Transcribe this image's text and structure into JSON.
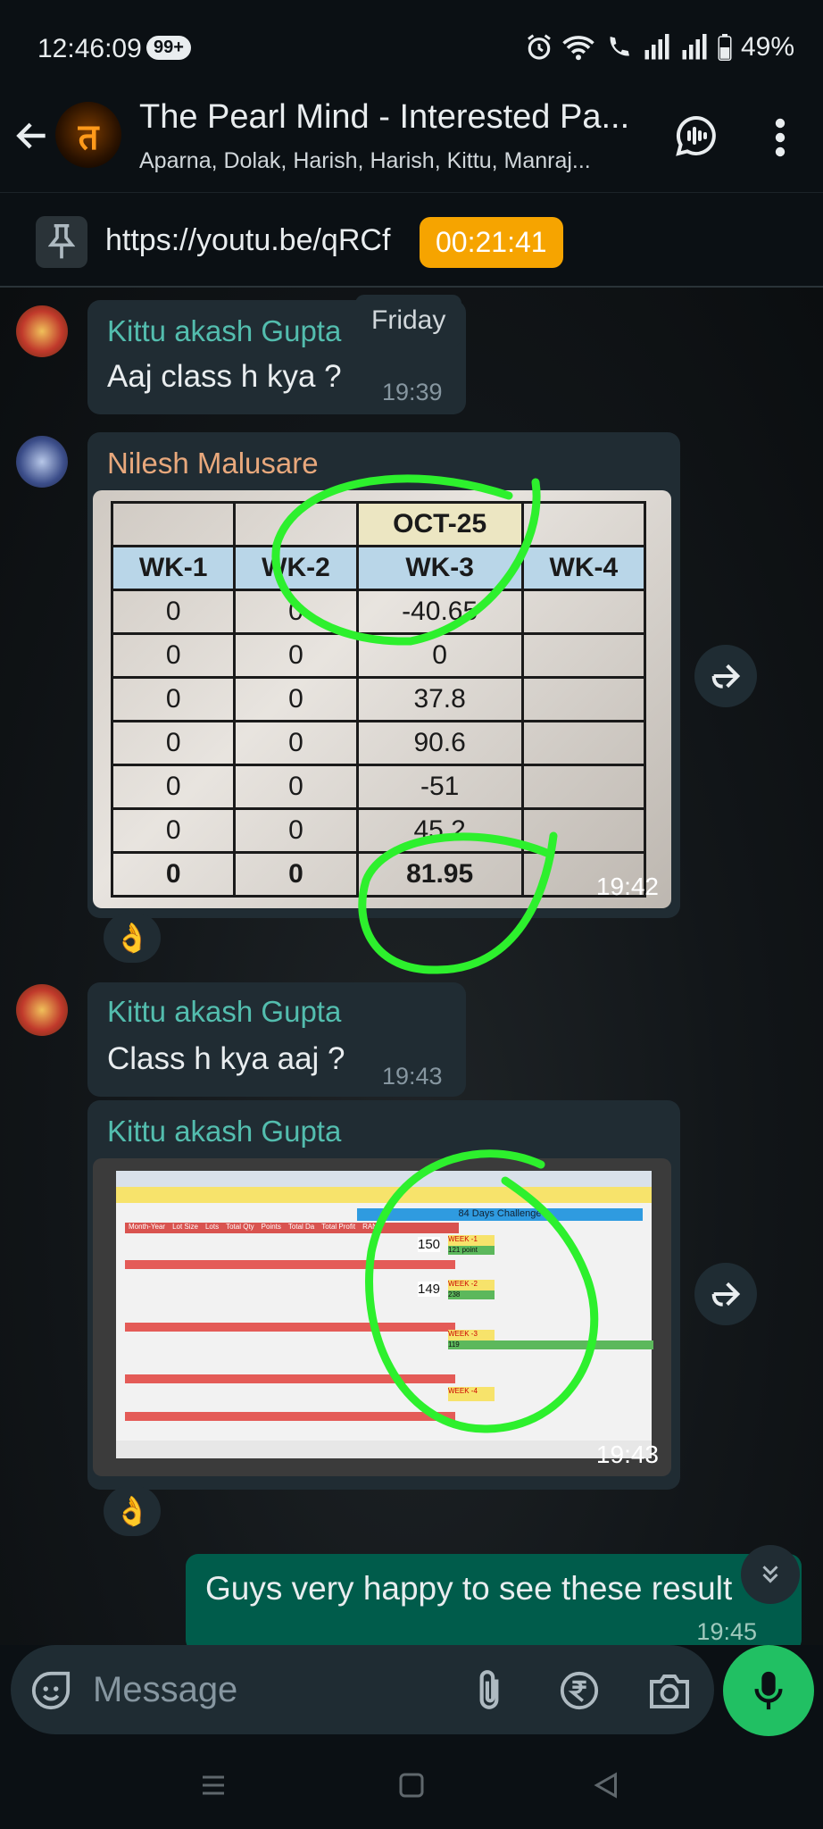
{
  "status_bar": {
    "time": "12:46:09",
    "notification_count": "99+",
    "battery": "49%"
  },
  "header": {
    "title": "The Pearl Mind - Interested Pa...",
    "subtitle": "Aparna, Dolak, Harish, Harish, Kittu, Manraj...",
    "avatar_glyph": "त"
  },
  "pinned": {
    "text": "https://youtu.be/qRCf",
    "timer": "00:21:41"
  },
  "chat": {
    "date_chip": "Friday",
    "messages": [
      {
        "sender": "Kittu akash Gupta",
        "text": "Aaj class h kya ?",
        "time": "19:39",
        "sender_color": "#53bdae"
      },
      {
        "sender": "Nilesh Malusare",
        "time": "19:42",
        "reaction": "👌",
        "sender_color": "#e8a87c"
      },
      {
        "sender": "Kittu akash Gupta",
        "text": "Class h kya aaj ?",
        "time": "19:43",
        "sender_color": "#53bdae"
      },
      {
        "sender": "Kittu akash Gupta",
        "time": "19:43",
        "reaction": "👌",
        "sender_color": "#53bdae"
      },
      {
        "text": "Guys very happy to see these result",
        "time": "19:45"
      }
    ]
  },
  "image1_table": {
    "month": "OCT-25",
    "headers": [
      "WK-1",
      "WK-2",
      "WK-3",
      "WK-4"
    ],
    "rows": [
      [
        "0",
        "0",
        "-40.65",
        ""
      ],
      [
        "0",
        "0",
        "0",
        ""
      ],
      [
        "0",
        "0",
        "37.8",
        ""
      ],
      [
        "0",
        "0",
        "90.6",
        ""
      ],
      [
        "0",
        "0",
        "-51",
        ""
      ],
      [
        "0",
        "0",
        "45.2",
        ""
      ]
    ],
    "total": [
      "0",
      "0",
      "81.95",
      ""
    ]
  },
  "image2_sheet": {
    "title": "84 Days Challenge",
    "headers": [
      "Month-Year",
      "Lot Size",
      "Lots",
      "Total Qty",
      "Points",
      "Total Da",
      "Total Profit",
      "RANK"
    ],
    "rank_values": [
      "150",
      "149"
    ],
    "weeks": [
      {
        "label": "WEEK -1",
        "value": "121 point"
      },
      {
        "label": "WEEK -2",
        "value": "238"
      },
      {
        "label": "WEEK -3",
        "value": "119"
      },
      {
        "label": "WEEK -4",
        "value": ""
      }
    ]
  },
  "input": {
    "placeholder": "Message"
  }
}
